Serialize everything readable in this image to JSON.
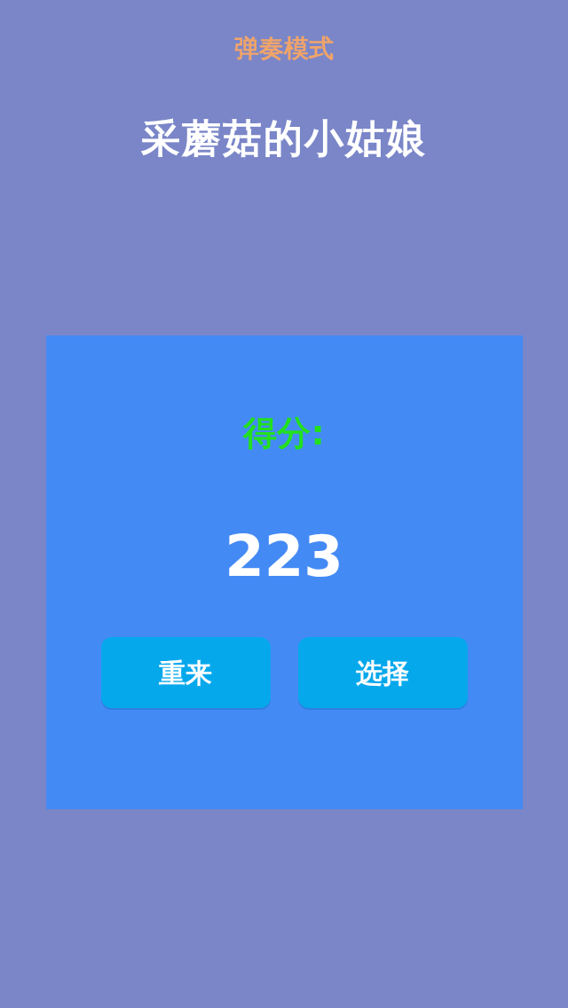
{
  "header": {
    "mode": "弹奏模式",
    "song_title": "采蘑菇的小姑娘"
  },
  "result_panel": {
    "score_label": "得分:",
    "score": "223",
    "buttons": [
      "重来",
      "选择"
    ]
  }
}
